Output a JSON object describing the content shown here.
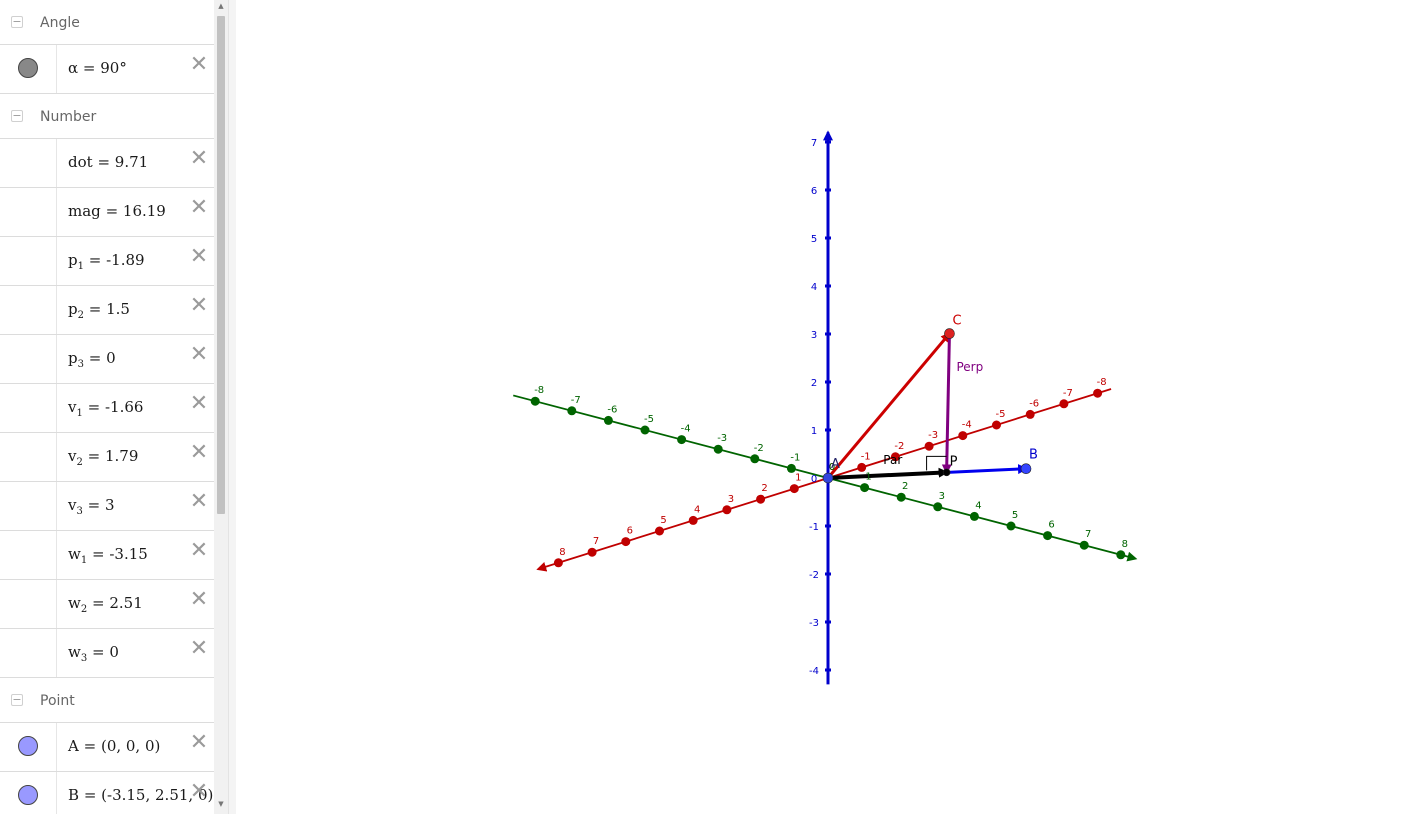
{
  "algebra": {
    "groups": [
      {
        "label": "Angle",
        "items": [
          {
            "name": "α",
            "sub": "",
            "value": "= 90°",
            "marker": true,
            "color": "#888888"
          }
        ]
      },
      {
        "label": "Number",
        "items": [
          {
            "name": "dot",
            "sub": "",
            "value": "= 9.71",
            "marker": false
          },
          {
            "name": "mag",
            "sub": "",
            "value": "= 16.19",
            "marker": false
          },
          {
            "name": "p",
            "sub": "1",
            "value": "= -1.89",
            "marker": false
          },
          {
            "name": "p",
            "sub": "2",
            "value": "= 1.5",
            "marker": false
          },
          {
            "name": "p",
            "sub": "3",
            "value": "= 0",
            "marker": false
          },
          {
            "name": "v",
            "sub": "1",
            "value": "= -1.66",
            "marker": false
          },
          {
            "name": "v",
            "sub": "2",
            "value": "= 1.79",
            "marker": false
          },
          {
            "name": "v",
            "sub": "3",
            "value": "= 3",
            "marker": false
          },
          {
            "name": "w",
            "sub": "1",
            "value": "= -3.15",
            "marker": false
          },
          {
            "name": "w",
            "sub": "2",
            "value": "= 2.51",
            "marker": false
          },
          {
            "name": "w",
            "sub": "3",
            "value": "= 0",
            "marker": false
          }
        ]
      },
      {
        "label": "Point",
        "items": [
          {
            "name": "A",
            "sub": "",
            "value": "= (0, 0, 0)",
            "marker": true,
            "color": "#9999ff"
          },
          {
            "name": "B",
            "sub": "",
            "value": "= (-3.15, 2.51, 0)",
            "marker": true,
            "color": "#9999ff"
          }
        ]
      }
    ],
    "delete_icon": "close-icon",
    "collapse_glyph": "−"
  },
  "graphics": {
    "colors": {
      "x_axis": "#c00000",
      "y_axis": "#006400",
      "z_axis": "#0000cc",
      "vector_C": "#cc0000",
      "vector_B": "#0000ee",
      "perp": "#800080",
      "par": "#000000"
    },
    "labels": {
      "A": "A",
      "B": "B",
      "C": "C",
      "P": "P",
      "perp": "Perp",
      "par": "Par"
    },
    "axes": {
      "x_ticks": [
        "-8",
        "-7",
        "-6",
        "-5",
        "-4",
        "-3",
        "-2",
        "-1",
        "0",
        "1",
        "2",
        "3",
        "4",
        "5",
        "6",
        "7",
        "8"
      ],
      "y_ticks": [
        "-8",
        "-7",
        "-6",
        "-5",
        "-4",
        "-3",
        "-2",
        "-1",
        "0",
        "1",
        "2",
        "3",
        "4",
        "5",
        "6",
        "7",
        "8"
      ],
      "z_ticks": [
        "-4",
        "-3",
        "-2",
        "-1",
        "0",
        "1",
        "2",
        "3",
        "4",
        "5",
        "6",
        "7"
      ]
    },
    "points": {
      "A": [
        0,
        0,
        0
      ],
      "B": [
        -3.15,
        2.51,
        0
      ],
      "C": [
        -1.66,
        1.79,
        3
      ],
      "P": [
        -1.89,
        1.5,
        0
      ]
    }
  }
}
